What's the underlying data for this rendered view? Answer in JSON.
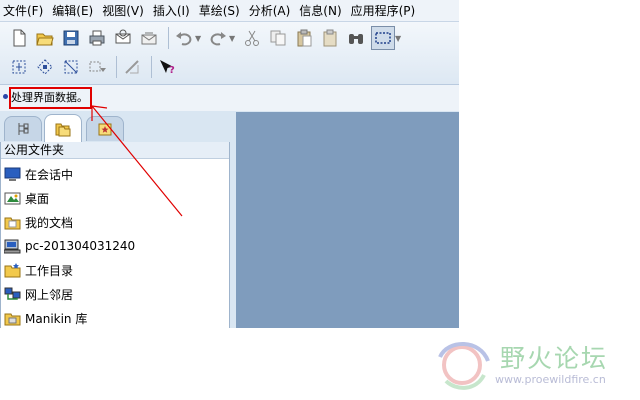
{
  "menu": {
    "items": [
      "文件(F)",
      "编辑(E)",
      "视图(V)",
      "插入(I)",
      "草绘(S)",
      "分析(A)",
      "信息(N)",
      "应用程序(P)"
    ]
  },
  "toolbar": {
    "row1": [
      "new-icon",
      "open-icon",
      "save-icon",
      "print-icon",
      "mail-icon",
      "mail-attach-icon",
      "undo-icon",
      "redo-icon",
      "cut-icon",
      "copy-icon",
      "paste-icon",
      "paste-special-icon",
      "find-icon",
      "select-box-icon"
    ],
    "row2": [
      "select-fit-icon",
      "select-vertex-icon",
      "select-crop-icon",
      "select-dropdown-icon",
      "measure-icon",
      "whats-this-icon"
    ]
  },
  "status": {
    "message": "处理界面数据。"
  },
  "navigator": {
    "tabs": [
      "model-tree-tab",
      "folder-browser-tab",
      "favorites-tab"
    ],
    "panel_title": "公用文件夹",
    "folders": [
      {
        "label": "在会话中",
        "icon": "monitor-icon"
      },
      {
        "label": "桌面",
        "icon": "desktop-icon"
      },
      {
        "label": "我的文档",
        "icon": "documents-folder-icon"
      },
      {
        "label": "pc-201304031240",
        "icon": "computer-icon"
      },
      {
        "label": "工作目录",
        "icon": "work-folder-icon"
      },
      {
        "label": "网上邻居",
        "icon": "network-icon"
      },
      {
        "label": "Manikin 库",
        "icon": "library-icon"
      }
    ]
  },
  "watermark": {
    "title": "野火论坛",
    "url": "www.proewildfire.cn"
  },
  "colors": {
    "graphics_bg": "#7f9cbd",
    "annotation": "#e00000",
    "chrome": "#d9e6f2"
  }
}
